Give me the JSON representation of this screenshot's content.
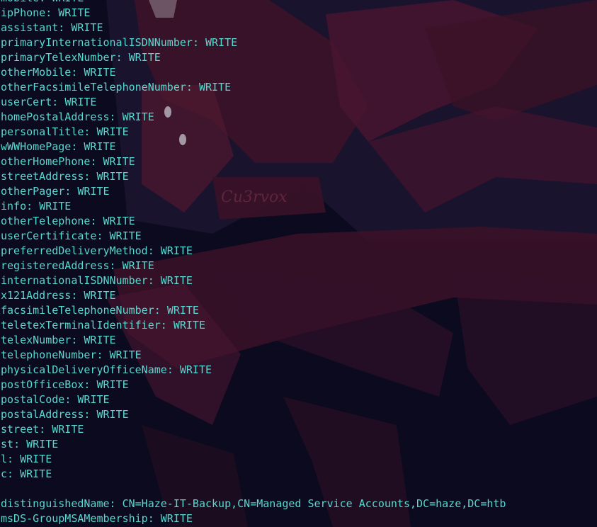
{
  "terminal": {
    "text_color": "#58d8d0",
    "background_color": "#0b0a1e",
    "lines": [
      {
        "key": "mobile",
        "value": "WRITE"
      },
      {
        "key": "ipPhone",
        "value": "WRITE"
      },
      {
        "key": "assistant",
        "value": "WRITE"
      },
      {
        "key": "primaryInternationalISDNNumber",
        "value": "WRITE"
      },
      {
        "key": "primaryTelexNumber",
        "value": "WRITE"
      },
      {
        "key": "otherMobile",
        "value": "WRITE"
      },
      {
        "key": "otherFacsimileTelephoneNumber",
        "value": "WRITE"
      },
      {
        "key": "userCert",
        "value": "WRITE"
      },
      {
        "key": "homePostalAddress",
        "value": "WRITE"
      },
      {
        "key": "personalTitle",
        "value": "WRITE"
      },
      {
        "key": "wWWHomePage",
        "value": "WRITE"
      },
      {
        "key": "otherHomePhone",
        "value": "WRITE"
      },
      {
        "key": "streetAddress",
        "value": "WRITE"
      },
      {
        "key": "otherPager",
        "value": "WRITE"
      },
      {
        "key": "info",
        "value": "WRITE"
      },
      {
        "key": "otherTelephone",
        "value": "WRITE"
      },
      {
        "key": "userCertificate",
        "value": "WRITE"
      },
      {
        "key": "preferredDeliveryMethod",
        "value": "WRITE"
      },
      {
        "key": "registeredAddress",
        "value": "WRITE"
      },
      {
        "key": "internationalISDNNumber",
        "value": "WRITE"
      },
      {
        "key": "x121Address",
        "value": "WRITE"
      },
      {
        "key": "facsimileTelephoneNumber",
        "value": "WRITE"
      },
      {
        "key": "teletexTerminalIdentifier",
        "value": "WRITE"
      },
      {
        "key": "telexNumber",
        "value": "WRITE"
      },
      {
        "key": "telephoneNumber",
        "value": "WRITE"
      },
      {
        "key": "physicalDeliveryOfficeName",
        "value": "WRITE"
      },
      {
        "key": "postOfficeBox",
        "value": "WRITE"
      },
      {
        "key": "postalCode",
        "value": "WRITE"
      },
      {
        "key": "postalAddress",
        "value": "WRITE"
      },
      {
        "key": "street",
        "value": "WRITE"
      },
      {
        "key": "st",
        "value": "WRITE"
      },
      {
        "key": "l",
        "value": "WRITE"
      },
      {
        "key": "c",
        "value": "WRITE"
      },
      {
        "key": "",
        "value": ""
      },
      {
        "key": "distinguishedName",
        "value": "CN=Haze-IT-Backup,CN=Managed Service Accounts,DC=haze,DC=htb"
      },
      {
        "key": "msDS-GroupMSAMembership",
        "value": "WRITE"
      }
    ]
  },
  "wallpaper": {
    "watermark_text": "Cu3rvox",
    "accent_color": "#5a1830",
    "accent_color_dark": "#3a1228"
  }
}
